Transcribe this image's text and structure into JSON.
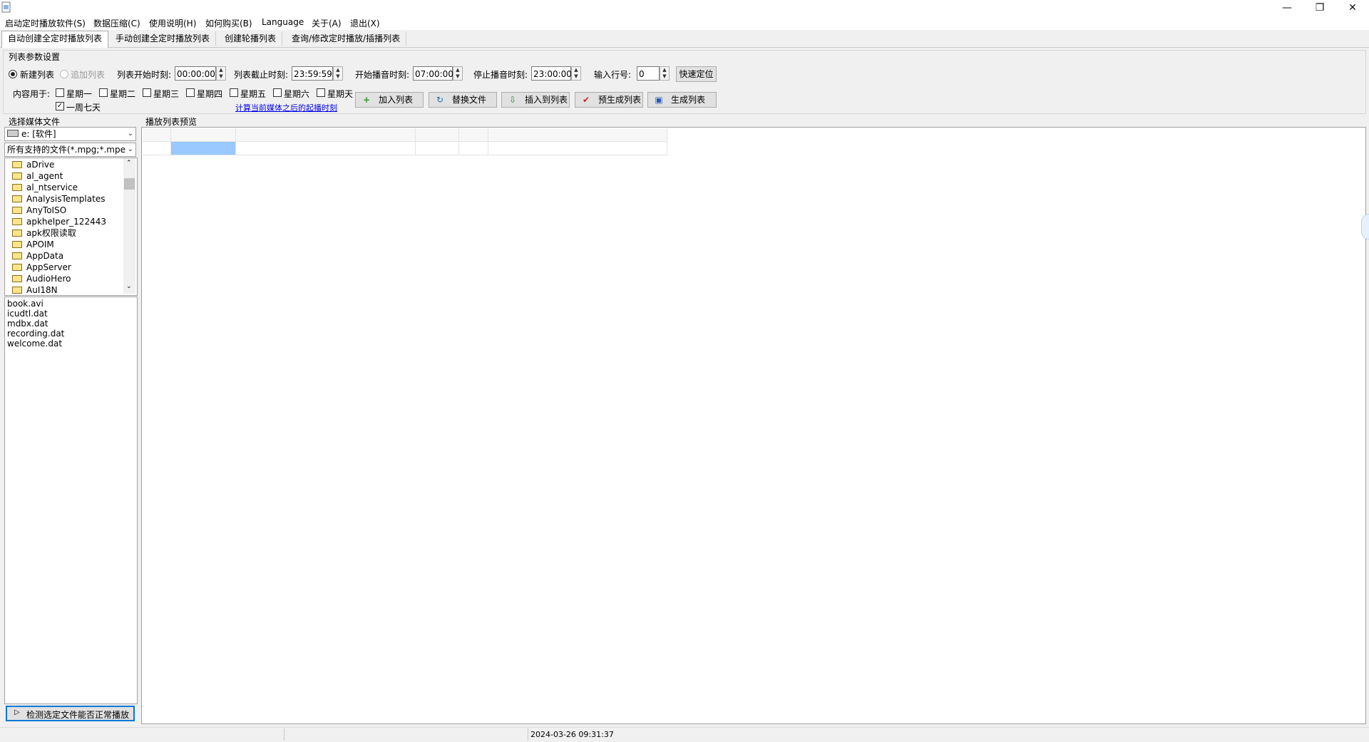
{
  "menu": [
    "启动定时播放软件(S)",
    "数据压缩(C)",
    "使用说明(H)",
    "如何购买(B)",
    "Language",
    "关于(A)",
    "退出(X)"
  ],
  "tabs": [
    "自动创建全定时播放列表",
    "手动创建全定时播放列表",
    "创建轮播列表",
    "查询/修改定时播放/插播列表"
  ],
  "params": {
    "group_title": "列表参数设置",
    "radio_new": "新建列表",
    "radio_append": "追加列表",
    "list_start_label": "列表开始时刻:",
    "list_start_value": "00:00:00",
    "list_end_label": "列表截止时刻:",
    "list_end_value": "23:59:59",
    "play_start_label": "开始播音时刻:",
    "play_start_value": "07:00:00",
    "play_stop_label": "停止播音时刻:",
    "play_stop_value": "23:00:00",
    "row_label": "输入行号:",
    "row_value": "0",
    "locate_button": "快速定位",
    "content_label": "内容用于:",
    "weekdays": [
      "星期一",
      "星期二",
      "星期三",
      "星期四",
      "星期五",
      "星期六",
      "星期天"
    ],
    "whole_week": "一周七天",
    "calc_link": "计算当前媒体之后的起播时刻",
    "buttons": {
      "add": "加入列表",
      "replace": "替换文件",
      "insert": "插入到列表",
      "pregenerate": "预生成列表",
      "generate": "生成列表"
    }
  },
  "left": {
    "title": "选择媒体文件",
    "drive": "e: [软件]",
    "filter": "所有支持的文件(*.mpg;*.mpe",
    "folders": [
      "aDrive",
      "al_agent",
      "al_ntservice",
      "AnalysisTemplates",
      "AnyToISO",
      "apkhelper_122443",
      "apk权限读取",
      "APOIM",
      "AppData",
      "AppServer",
      "AudioHero",
      "AuI18N"
    ],
    "files": [
      "book.avi",
      "icudtl.dat",
      "mdbx.dat",
      "recording.dat",
      "welcome.dat"
    ],
    "check_button": "检测选定文件能否正常播放"
  },
  "preview": {
    "title": "播放列表预览"
  },
  "status": {
    "datetime": "2024-03-26 09:31:37"
  },
  "colors": {
    "link": "#0000ee",
    "selection": "#99c9ff",
    "focus_border": "#0078d7"
  }
}
